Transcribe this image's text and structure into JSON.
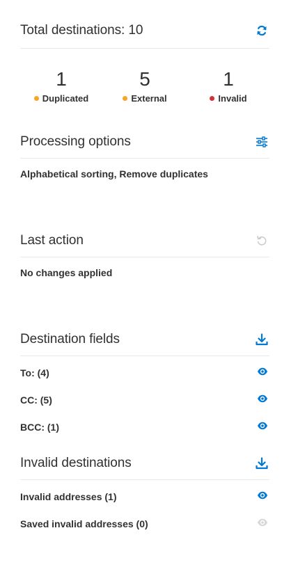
{
  "summary": {
    "title": "Total destinations: 10",
    "refresh_icon": "refresh-icon",
    "stats": [
      {
        "value": "1",
        "label": "Duplicated",
        "color": "#f5a623"
      },
      {
        "value": "5",
        "label": "External",
        "color": "#f5a623"
      },
      {
        "value": "1",
        "label": "Invalid",
        "color": "#d13438"
      }
    ]
  },
  "processing": {
    "title": "Processing options",
    "icon": "settings-sliders-icon",
    "description": "Alphabetical sorting, Remove duplicates"
  },
  "last_action": {
    "title": "Last action",
    "icon": "undo-icon",
    "description": "No changes applied"
  },
  "destination_fields": {
    "title": "Destination fields",
    "icon": "download-icon",
    "rows": [
      {
        "label": "To: (4)",
        "icon": "eye-icon"
      },
      {
        "label": "CC: (5)",
        "icon": "eye-icon"
      },
      {
        "label": "BCC: (1)",
        "icon": "eye-icon"
      }
    ]
  },
  "invalid_destinations": {
    "title": "Invalid destinations",
    "icon": "download-icon",
    "rows": [
      {
        "label": "Invalid addresses (1)",
        "icon": "eye-icon",
        "enabled": true
      },
      {
        "label": "Saved invalid addresses (0)",
        "icon": "eye-icon",
        "enabled": false
      }
    ]
  },
  "colors": {
    "accent": "#0078d4",
    "disabled": "#c8c6c4",
    "warning": "#f5a623",
    "error": "#d13438"
  }
}
